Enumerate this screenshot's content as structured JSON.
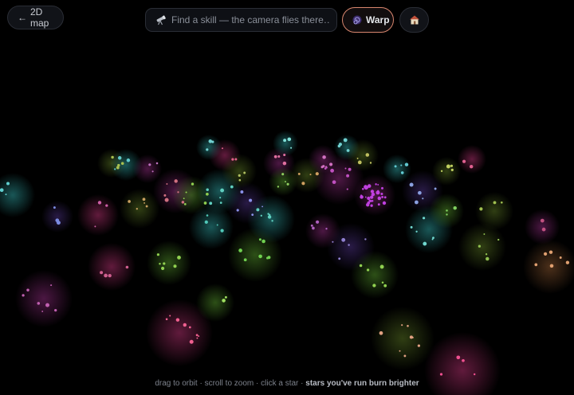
{
  "topbar": {
    "back_arrow": "←",
    "back_label": "2D map",
    "search_placeholder": "Find a skill — the camera flies there…",
    "warp_label": "Warp",
    "icons": {
      "back": "left-arrow-icon",
      "search": "telescope-icon",
      "warp": "galaxy-swirl-icon",
      "home": "house-icon"
    }
  },
  "hint": {
    "text": "drag to orbit · scroll to zoom · click a star · ",
    "bold": "stars you've run burn brighter"
  },
  "colors": {
    "background": "#000000",
    "warp_border": "#d8866e",
    "nebula_palette": [
      "#2a8c8c",
      "#5a9a2e",
      "#7a2a6a",
      "#a0306e",
      "#9a6a2a",
      "#4a3a8a"
    ]
  }
}
